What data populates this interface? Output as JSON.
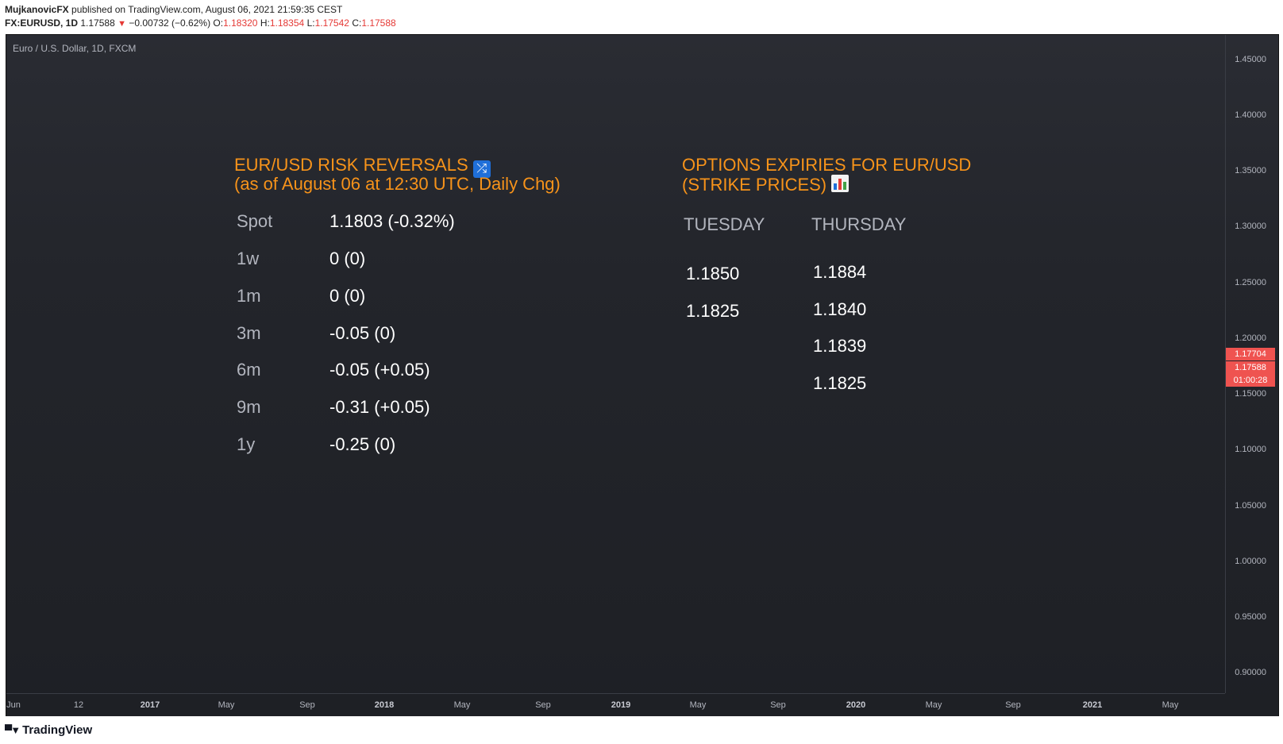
{
  "header": {
    "author": "MujkanovicFX",
    "published": "published on TradingView.com, August 06, 2021 21:59:35 CEST",
    "symbol": "FX:EURUSD, 1D",
    "last": "1.17588",
    "change": "−0.00732 (−0.62%)",
    "o_label": "O:",
    "o_value": "1.18320",
    "h_label": "H:",
    "h_value": "1.18354",
    "l_label": "L:",
    "l_value": "1.17542",
    "c_label": "C:",
    "c_value": "1.17588"
  },
  "chart": {
    "title": "Euro / U.S. Dollar, 1D, FXCM",
    "price_ticks": [
      "1.45000",
      "1.40000",
      "1.35000",
      "1.30000",
      "1.25000",
      "1.20000",
      "1.15000",
      "1.10000",
      "1.05000",
      "1.00000",
      "0.95000",
      "0.90000"
    ],
    "price_tags": [
      "1.17704",
      "1.17588",
      "01:00:28"
    ],
    "time_ticks": [
      {
        "label": "Jun",
        "bold": false
      },
      {
        "label": "12",
        "bold": false
      },
      {
        "label": "2017",
        "bold": true
      },
      {
        "label": "May",
        "bold": false
      },
      {
        "label": "Sep",
        "bold": false
      },
      {
        "label": "2018",
        "bold": true
      },
      {
        "label": "May",
        "bold": false
      },
      {
        "label": "Sep",
        "bold": false
      },
      {
        "label": "2019",
        "bold": true
      },
      {
        "label": "May",
        "bold": false
      },
      {
        "label": "Sep",
        "bold": false
      },
      {
        "label": "2020",
        "bold": true
      },
      {
        "label": "May",
        "bold": false
      },
      {
        "label": "Sep",
        "bold": false
      },
      {
        "label": "2021",
        "bold": true
      },
      {
        "label": "May",
        "bold": false
      }
    ]
  },
  "risk_reversals": {
    "title_line1": "EUR/USD RISK REVERSALS",
    "title_line2": "(as of August 06 at 12:30 UTC, Daily Chg)",
    "icon": "shuffle-icon",
    "rows": [
      {
        "label": "Spot",
        "value": "1.1803 (-0.32%)"
      },
      {
        "label": "1w",
        "value": "0 (0)"
      },
      {
        "label": "1m",
        "value": "0 (0)"
      },
      {
        "label": "3m",
        "value": "-0.05 (0)"
      },
      {
        "label": "6m",
        "value": "-0.05 (+0.05)"
      },
      {
        "label": "9m",
        "value": "-0.31 (+0.05)"
      },
      {
        "label": "1y",
        "value": "-0.25 (0)"
      }
    ]
  },
  "options_expiries": {
    "title_line1": "OPTIONS EXPIRIES FOR EUR/USD",
    "title_line2": "(STRIKE PRICES)",
    "icon": "bar-chart-icon",
    "tuesday": {
      "header": "TUESDAY",
      "strikes": [
        "1.1850",
        "1.1825"
      ]
    },
    "thursday": {
      "header": "THURSDAY",
      "strikes": [
        "1.1884",
        "1.1840",
        "1.1839",
        "1.1825"
      ]
    }
  },
  "footer": {
    "brand": "TradingView"
  },
  "colors": {
    "accent_orange": "#f7931a",
    "down_red": "#ef5350",
    "background": "#1e2025"
  }
}
